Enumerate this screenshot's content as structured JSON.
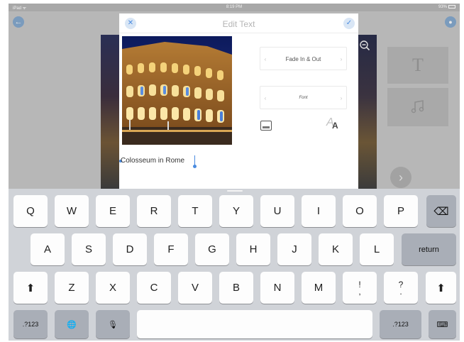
{
  "status_bar": {
    "left": "iPad ᯤ",
    "time": "8:19 PM",
    "battery": "93%"
  },
  "background_app": {
    "back_icon": "back-arrow-icon",
    "corner_icon": "settings-icon",
    "zoom_icon": "zoom-out-icon",
    "text_tool_icon": "T",
    "music_tool_icon": "music-note-icon",
    "next_icon": "chevron-right-icon"
  },
  "modal": {
    "title": "Edit Text",
    "close_icon": "close-icon",
    "confirm_icon": "checkmark-icon",
    "text_value": "Colosseum in Rome",
    "animation_selector": {
      "value": "Fade In & Out",
      "prev": "‹",
      "next": "›"
    },
    "font_selector": {
      "value": "Font",
      "prev": "‹",
      "next": "›"
    },
    "text_style_icon": {
      "back": "A",
      "front": "A"
    }
  },
  "keyboard": {
    "row1": [
      "Q",
      "W",
      "E",
      "R",
      "T",
      "Y",
      "U",
      "I",
      "O",
      "P"
    ],
    "row2": [
      "A",
      "S",
      "D",
      "F",
      "G",
      "H",
      "J",
      "K",
      "L"
    ],
    "row3": [
      "Z",
      "X",
      "C",
      "V",
      "B",
      "N",
      "M"
    ],
    "punct1": [
      "!",
      ","
    ],
    "punct2": [
      "?",
      "."
    ],
    "return_label": "return",
    "numbers_label": ".?123",
    "shift_glyph": "⬆",
    "delete_glyph": "⌫",
    "globe_glyph": "🌐",
    "mic_glyph": "🎙",
    "hide_glyph": "⌨"
  },
  "colors": {
    "accent": "#4a8be0",
    "keyboard_bg": "#d0d3d8",
    "key_light": "#fdfdfd",
    "key_dark": "#a9aeb7"
  }
}
